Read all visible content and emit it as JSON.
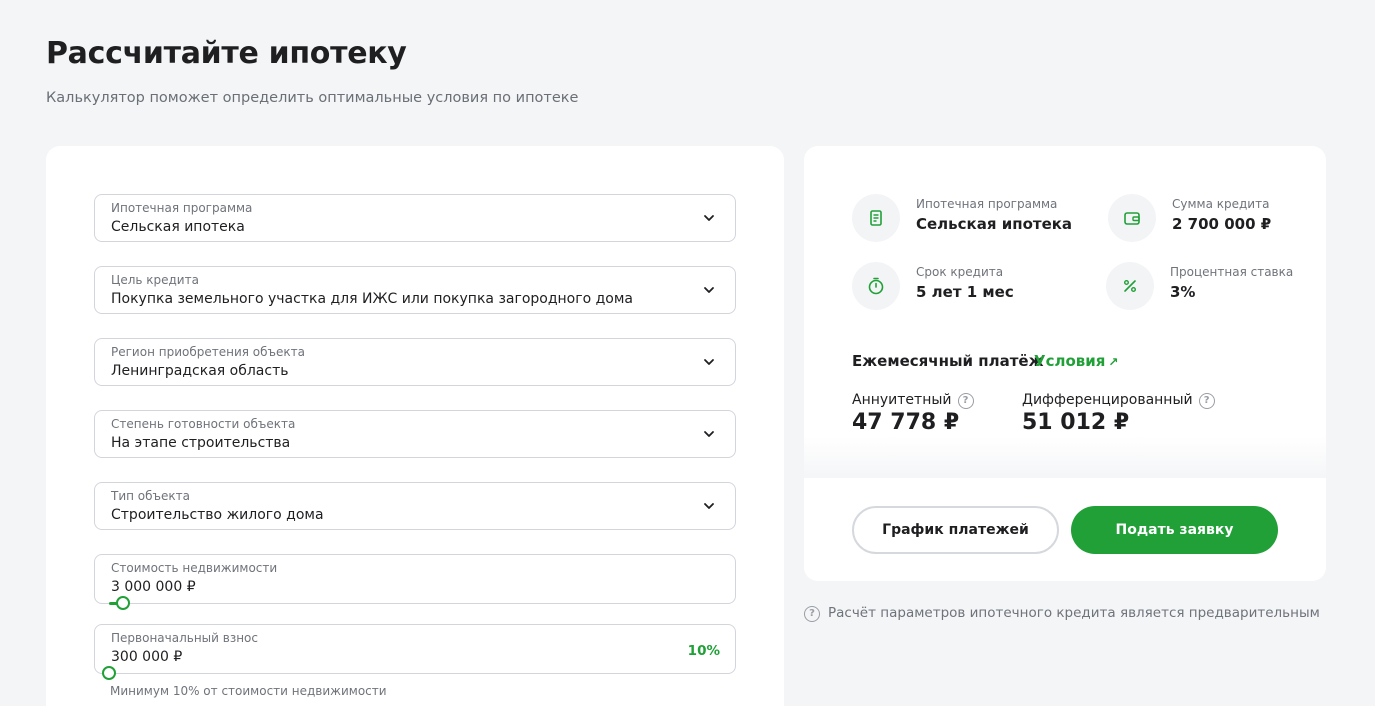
{
  "page": {
    "title": "Рассчитайте ипотеку",
    "subtitle": "Калькулятор поможет определить оптимальные условия по ипотеке"
  },
  "form": {
    "program": {
      "label": "Ипотечная программа",
      "value": "Сельская ипотека"
    },
    "purpose": {
      "label": "Цель кредита",
      "value": "Покупка земельного участка для ИЖС или покупка загородного дома"
    },
    "region": {
      "label": "Регион приобретения объекта",
      "value": "Ленинградская область"
    },
    "readiness": {
      "label": "Степень готовности объекта",
      "value": "На этапе строительства"
    },
    "object_type": {
      "label": "Тип объекта",
      "value": "Строительство жилого дома"
    },
    "property_cost": {
      "label": "Стоимость недвижимости",
      "value": "3 000 000 ₽",
      "slider_fraction": 0.023
    },
    "down_payment": {
      "label": "Первоначальный взнос",
      "value": "300 000 ₽",
      "percent": "10%",
      "slider_fraction": 0.0,
      "hint": "Минимум 10% от стоимости недвижимости"
    }
  },
  "result": {
    "program": {
      "label": "Ипотечная программа",
      "value": "Сельская ипотека",
      "icon": "document-icon"
    },
    "loan_amount": {
      "label": "Сумма кредита",
      "value": "2 700 000 ₽",
      "icon": "wallet-icon"
    },
    "term": {
      "label": "Срок кредита",
      "value": "5 лет 1 мес",
      "icon": "stopwatch-icon"
    },
    "rate": {
      "label": "Процентная ставка",
      "value": "3%",
      "icon": "percent-icon"
    },
    "monthly_title": "Ежемесячный платёж",
    "conditions_link": "Условия",
    "annuity": {
      "label": "Аннуитетный",
      "value": "47 778 ₽"
    },
    "differentiated": {
      "label": "Дифференцированный",
      "value": "51 012 ₽"
    },
    "schedule_button": "График платежей",
    "apply_button": "Подать заявку"
  },
  "disclaimer": "Расчёт параметров ипотечного кредита является предварительным",
  "colors": {
    "accent": "#21a038",
    "background": "#f3f5f7",
    "card": "#ffffff"
  }
}
